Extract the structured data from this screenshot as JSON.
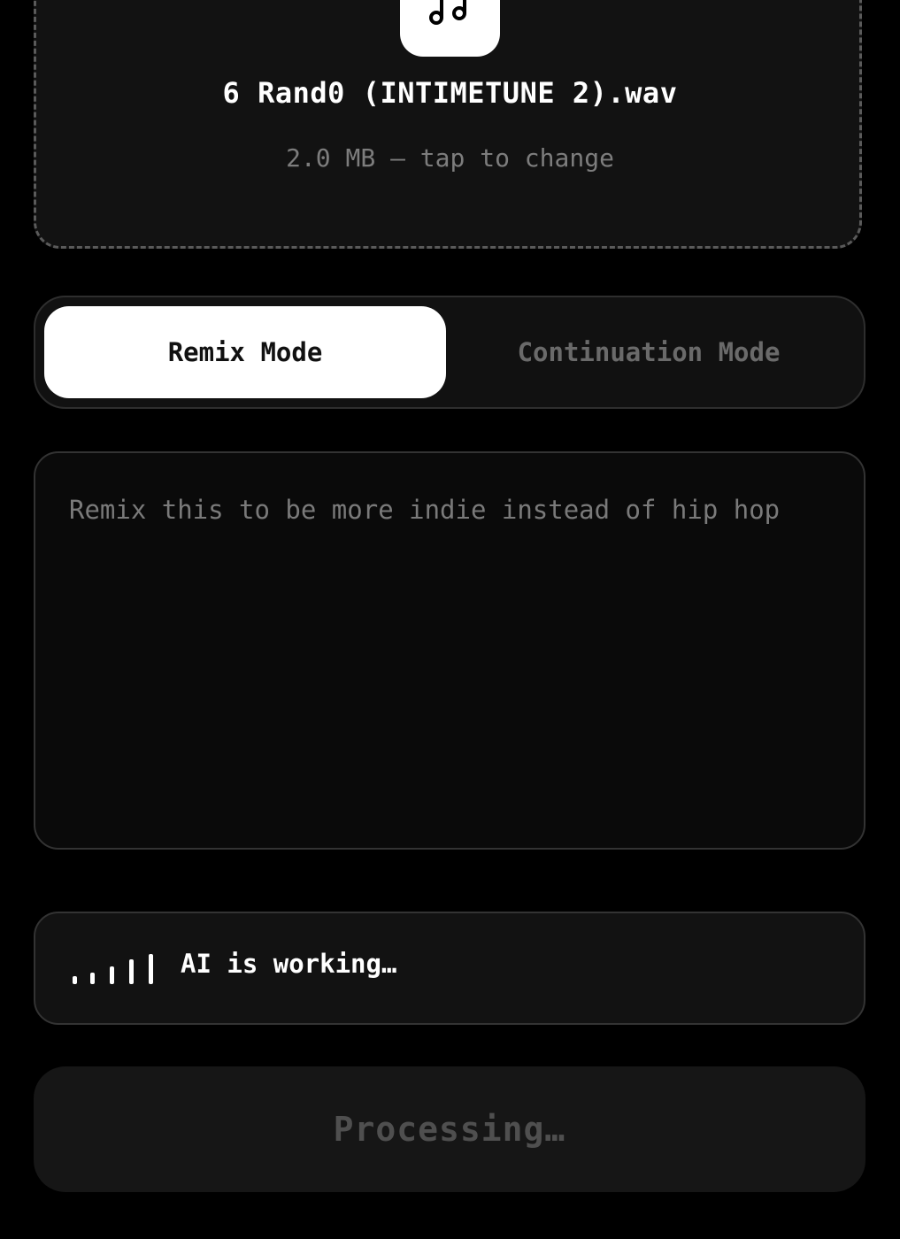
{
  "upload": {
    "file_name": "6 Rand0 (INTIMETUNE 2).wav",
    "file_meta": "2.0 MB — tap to change",
    "icon": "music-note-icon"
  },
  "modes": {
    "active_label": "Remix Mode",
    "inactive_label": "Continuation Mode",
    "selected": "Remix Mode"
  },
  "prompt": {
    "value": "Remix this to be more indie instead of hip hop"
  },
  "status": {
    "icon": "waveform-icon",
    "text": "AI is working…"
  },
  "submit": {
    "label": "Processing…"
  },
  "colors": {
    "background": "#000000",
    "panel": "#121212",
    "active_toggle": "#ffffff",
    "muted_text": "#6a6a6a"
  }
}
